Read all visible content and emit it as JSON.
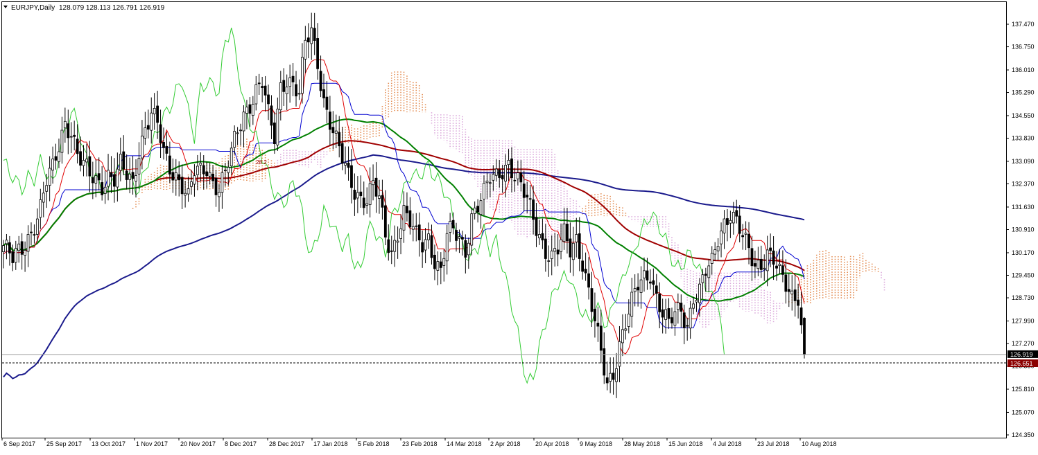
{
  "header": {
    "symbol_label": "EURJPY,Daily",
    "ohlc": "128.079 128.113 126.791 126.919",
    "menu_icon": "triangle-down-icon"
  },
  "chart_data": {
    "type": "candlestick",
    "symbol": "EURJPY",
    "timeframe": "Daily",
    "ylim": [
      124.35,
      138.0
    ],
    "y_ticks": [
      "137.470",
      "136.750",
      "136.010",
      "135.290",
      "134.550",
      "133.830",
      "133.090",
      "132.370",
      "131.630",
      "130.910",
      "130.170",
      "129.450",
      "128.730",
      "127.990",
      "127.270",
      "126.550",
      "125.810",
      "125.070",
      "124.350"
    ],
    "x_ticks": [
      "6 Sep 2017",
      "25 Sep 2017",
      "13 Oct 2017",
      "1 Nov 2017",
      "20 Nov 2017",
      "8 Dec 2017",
      "28 Dec 2017",
      "17 Jan 2018",
      "5 Feb 2018",
      "23 Feb 2018",
      "14 Mar 2018",
      "2 Apr 2018",
      "20 Apr 2018",
      "9 May 2018",
      "28 May 2018",
      "15 Jun 2018",
      "4 Jul 2018",
      "23 Jul 2018",
      "10 Aug 2018"
    ],
    "current_price": "126.919",
    "level_price": "126.651",
    "level_label": "28.2",
    "grid": false,
    "colors": {
      "candle": "#000000",
      "ma_green": "#008000",
      "ma_darkred": "#a00000",
      "ma_navy": "#1a1a8c",
      "tenkan": "#e00000",
      "kijun": "#0000d0",
      "chikou": "#33cc33",
      "cloud_bull": "#e08040",
      "cloud_bear": "#d8a0d8",
      "current_price_tag": "#000000",
      "level_tag": "#8b0000"
    },
    "close_path": [
      [
        0,
        130.4
      ],
      [
        3,
        129.9
      ],
      [
        6,
        130.3
      ],
      [
        9,
        130.9
      ],
      [
        12,
        131.6
      ],
      [
        14,
        132.4
      ],
      [
        16,
        132.8
      ],
      [
        18,
        133.6
      ],
      [
        20,
        134.4
      ],
      [
        22,
        134.1
      ],
      [
        24,
        133.3
      ],
      [
        26,
        132.9
      ],
      [
        28,
        132.6
      ],
      [
        30,
        132.5
      ],
      [
        32,
        132.4
      ],
      [
        34,
        132.7
      ],
      [
        36,
        132.5
      ],
      [
        38,
        132.9
      ],
      [
        40,
        132.6
      ],
      [
        42,
        132.4
      ],
      [
        44,
        133.5
      ],
      [
        46,
        134.2
      ],
      [
        48,
        134.6
      ],
      [
        50,
        134.2
      ],
      [
        52,
        133.3
      ],
      [
        54,
        132.9
      ],
      [
        56,
        132.7
      ],
      [
        58,
        132.4
      ],
      [
        60,
        131.9
      ],
      [
        62,
        132.7
      ],
      [
        64,
        132.7
      ],
      [
        66,
        132.9
      ],
      [
        68,
        132.5
      ],
      [
        70,
        132.3
      ],
      [
        72,
        132.7
      ],
      [
        74,
        133.3
      ],
      [
        76,
        134.0
      ],
      [
        78,
        134.6
      ],
      [
        80,
        135.0
      ],
      [
        82,
        135.4
      ],
      [
        84,
        135.6
      ],
      [
        86,
        134.5
      ],
      [
        88,
        133.8
      ],
      [
        90,
        135.5
      ],
      [
        92,
        135.8
      ],
      [
        94,
        135.6
      ],
      [
        96,
        135.2
      ],
      [
        98,
        136.8
      ],
      [
        100,
        137.2
      ],
      [
        102,
        136.3
      ],
      [
        104,
        135.1
      ],
      [
        106,
        134.4
      ],
      [
        108,
        133.7
      ],
      [
        110,
        133.1
      ],
      [
        112,
        132.6
      ],
      [
        114,
        132.2
      ],
      [
        116,
        132.0
      ],
      [
        118,
        131.9
      ],
      [
        120,
        132.3
      ],
      [
        122,
        131.8
      ],
      [
        124,
        130.7
      ],
      [
        126,
        130.2
      ],
      [
        128,
        130.9
      ],
      [
        130,
        131.5
      ],
      [
        132,
        131.1
      ],
      [
        134,
        130.6
      ],
      [
        136,
        130.4
      ],
      [
        138,
        130.7
      ],
      [
        140,
        130.0
      ],
      [
        142,
        129.6
      ],
      [
        144,
        130.7
      ],
      [
        146,
        130.8
      ],
      [
        148,
        130.6
      ],
      [
        150,
        130.3
      ],
      [
        152,
        131.4
      ],
      [
        154,
        131.7
      ],
      [
        156,
        132.0
      ],
      [
        158,
        132.5
      ],
      [
        160,
        132.6
      ],
      [
        162,
        132.9
      ],
      [
        164,
        133.1
      ],
      [
        166,
        132.6
      ],
      [
        168,
        132.2
      ],
      [
        170,
        131.8
      ],
      [
        172,
        131.3
      ],
      [
        174,
        130.8
      ],
      [
        176,
        130.3
      ],
      [
        178,
        130.0
      ],
      [
        180,
        130.2
      ],
      [
        182,
        130.7
      ],
      [
        184,
        130.3
      ],
      [
        186,
        130.7
      ],
      [
        188,
        129.9
      ],
      [
        190,
        128.9
      ],
      [
        192,
        127.9
      ],
      [
        194,
        126.9
      ],
      [
        196,
        126.0
      ],
      [
        198,
        126.4
      ],
      [
        200,
        127.3
      ],
      [
        202,
        127.9
      ],
      [
        204,
        128.5
      ],
      [
        206,
        129.1
      ],
      [
        208,
        129.4
      ],
      [
        210,
        129.6
      ],
      [
        212,
        128.8
      ],
      [
        214,
        128.2
      ],
      [
        216,
        127.8
      ],
      [
        218,
        128.2
      ],
      [
        220,
        128.4
      ],
      [
        222,
        127.9
      ],
      [
        224,
        128.8
      ],
      [
        226,
        128.9
      ],
      [
        228,
        129.5
      ],
      [
        230,
        129.8
      ],
      [
        232,
        130.7
      ],
      [
        234,
        131.2
      ],
      [
        236,
        131.5
      ],
      [
        238,
        131.1
      ],
      [
        240,
        130.6
      ],
      [
        242,
        130.2
      ],
      [
        244,
        129.8
      ],
      [
        246,
        129.9
      ],
      [
        248,
        130.2
      ],
      [
        250,
        129.9
      ],
      [
        252,
        129.4
      ],
      [
        254,
        129.1
      ],
      [
        256,
        128.8
      ],
      [
        258,
        128.9
      ],
      [
        260,
        126.9
      ]
    ]
  }
}
